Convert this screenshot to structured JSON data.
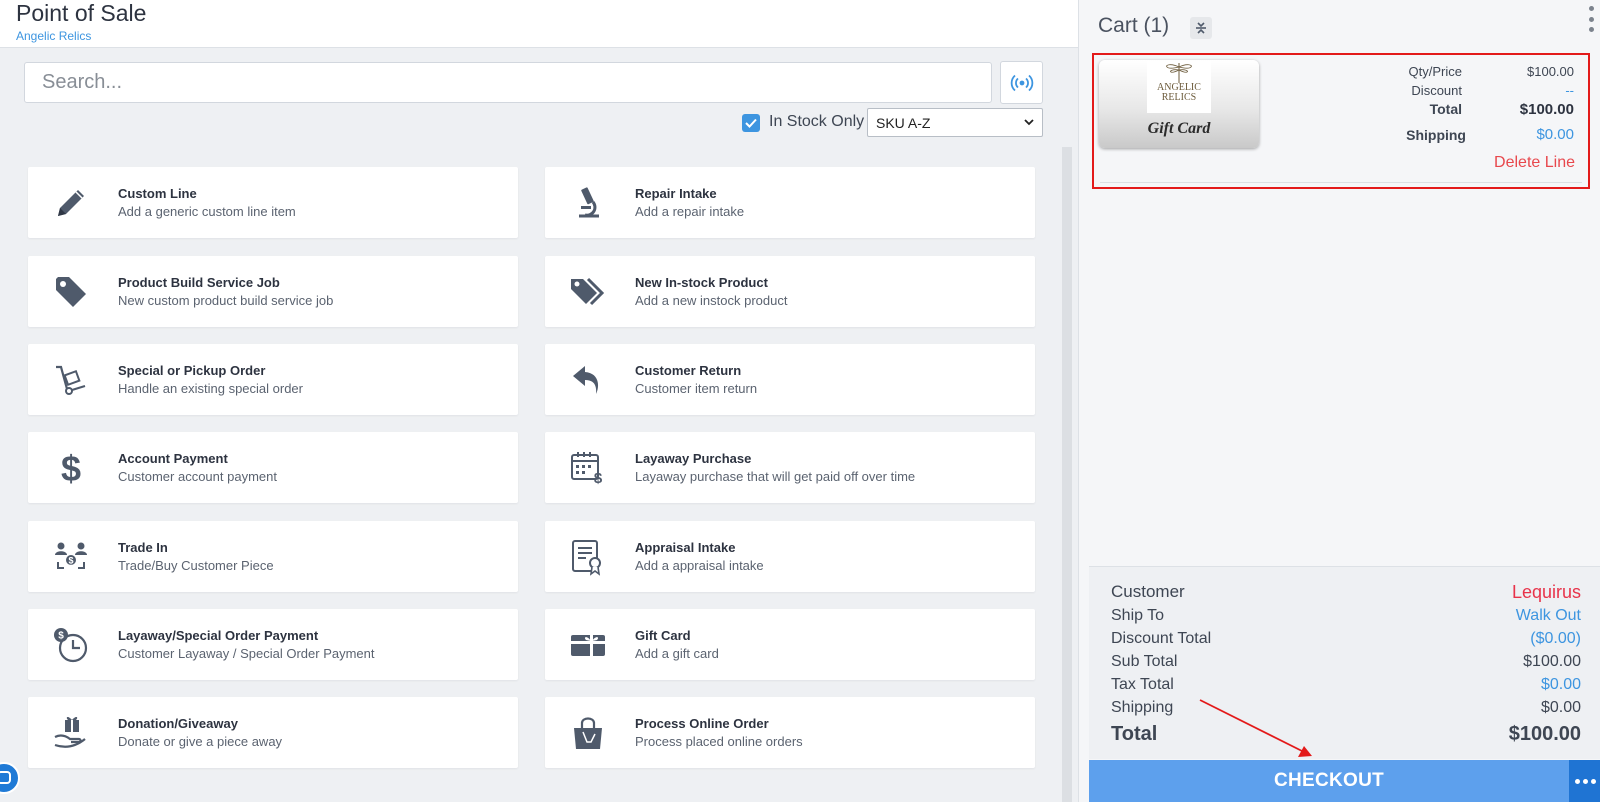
{
  "header": {
    "title": "Point of Sale",
    "subtitle": "Angelic Relics"
  },
  "search": {
    "placeholder": "Search..."
  },
  "filters": {
    "in_stock_label": "In Stock Only",
    "in_stock_checked": true,
    "sort_value": "SKU A-Z"
  },
  "tiles": [
    {
      "name": "Custom Line",
      "desc": "Add a generic custom line item",
      "icon": "pencil-icon"
    },
    {
      "name": "Repair Intake",
      "desc": "Add a repair intake",
      "icon": "microscope-icon"
    },
    {
      "name": "Product Build Service Job",
      "desc": "New custom product build service job",
      "icon": "tag-icon"
    },
    {
      "name": "New In-stock Product",
      "desc": "Add a new instock product",
      "icon": "tags-icon"
    },
    {
      "name": "Special or Pickup Order",
      "desc": "Handle an existing special order",
      "icon": "hand-truck-icon"
    },
    {
      "name": "Customer Return",
      "desc": "Customer item return",
      "icon": "reply-arrow-icon"
    },
    {
      "name": "Account Payment",
      "desc": "Customer account payment",
      "icon": "dollar-icon"
    },
    {
      "name": "Layaway Purchase",
      "desc": "Layaway purchase that will get paid off over time",
      "icon": "calendar-dollar-icon"
    },
    {
      "name": "Trade In",
      "desc": "Trade/Buy Customer Piece",
      "icon": "trade-exchange-icon"
    },
    {
      "name": "Appraisal Intake",
      "desc": "Add a appraisal intake",
      "icon": "certificate-icon"
    },
    {
      "name": "Layaway/Special Order Payment",
      "desc": "Customer Layaway / Special Order Payment",
      "icon": "clock-dollar-icon"
    },
    {
      "name": "Gift Card",
      "desc": "Add a gift card",
      "icon": "gift-card-icon"
    },
    {
      "name": "Donation/Giveaway",
      "desc": "Donate or give a piece away",
      "icon": "hand-gift-icon"
    },
    {
      "name": "Process Online Order",
      "desc": "Process placed online orders",
      "icon": "shopping-bag-icon"
    }
  ],
  "cart": {
    "title": "Cart (1)",
    "line": {
      "image_label": "Gift Card",
      "brand_top": "ANGELIC",
      "brand_bottom": "RELICS",
      "qty_price_label": "Qty/Price",
      "qty_price_value": "$100.00",
      "discount_label": "Discount",
      "discount_value": "--",
      "total_label": "Total",
      "total_value": "$100.00",
      "shipping_label": "Shipping",
      "shipping_value": "$0.00",
      "delete_label": "Delete Line"
    },
    "summary": {
      "customer_label": "Customer",
      "customer_value": "Lequirus",
      "ship_to_label": "Ship To",
      "ship_to_value": "Walk Out",
      "discount_total_label": "Discount Total",
      "discount_total_value": "($0.00)",
      "sub_total_label": "Sub Total",
      "sub_total_value": "$100.00",
      "tax_total_label": "Tax Total",
      "tax_total_value": "$0.00",
      "shipping_label": "Shipping",
      "shipping_value": "$0.00",
      "total_label": "Total",
      "total_value": "$100.00"
    },
    "checkout_label": "CHECKOUT"
  },
  "colors": {
    "accent_blue": "#3d95e0",
    "checkout_blue": "#5da0ed",
    "danger_red": "#e31a1a",
    "customer_red": "#e8334a"
  }
}
